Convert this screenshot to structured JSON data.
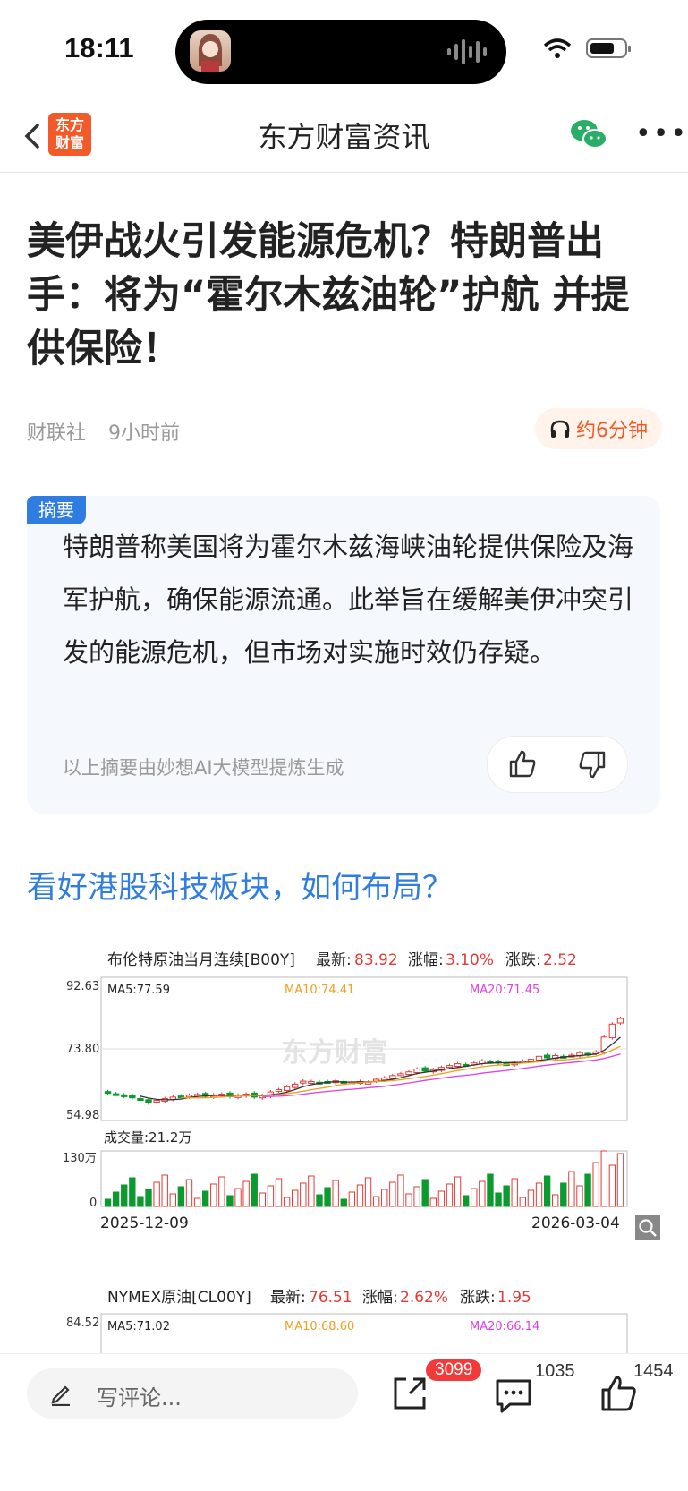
{
  "status": {
    "time": "18:11"
  },
  "nav": {
    "logo_line1": "东方",
    "logo_line2": "财富",
    "title": "东方财富资讯"
  },
  "article": {
    "headline": "美伊战火引发能源危机？特朗普出手：将为“霍尔木兹油轮”护航 并提供保险！",
    "source": "财联社",
    "time_ago": "9小时前",
    "listen_label": "约6分钟"
  },
  "summary": {
    "tag": "摘要",
    "text": "特朗普称美国将为霍尔木兹海峡油轮提供保险及海军护航，确保能源流通。此举旨在缓解美伊冲突引发的能源危机，但市场对实施时效仍存疑。",
    "note": "以上摘要由妙想AI大模型提炼生成"
  },
  "link_title": "看好港股科技板块，如何布局？",
  "chart_data": [
    {
      "type": "candlestick",
      "title": "布伦特原油当月连续[B00Y]",
      "latest_label": "最新:",
      "latest": "83.92",
      "change_pct_label": "涨幅:",
      "change_pct": "3.10%",
      "change_label": "涨跌:",
      "change": "2.52",
      "ma5": "MA5:77.59",
      "ma10": "MA10:74.41",
      "ma20": "MA20:71.45",
      "y_ticks": [
        "92.63",
        "73.80",
        "54.98"
      ],
      "ylim": [
        54.98,
        92.63
      ],
      "watermark": "东方财富",
      "volume_label": "成交量:21.2万",
      "volume_ticks": [
        "130万",
        "0"
      ],
      "x_start": "2025-12-09",
      "x_end": "2026-03-04",
      "close": [
        61.9,
        61.6,
        61.0,
        60.6,
        60.3,
        59.2,
        59.9,
        60.4,
        60.8,
        61.0,
        61.3,
        61.5,
        61.0,
        61.4,
        61.6,
        60.9,
        61.3,
        61.6,
        60.8,
        61.2,
        62.2,
        62.8,
        63.6,
        64.3,
        65.1,
        65.0,
        64.7,
        64.9,
        65.2,
        64.6,
        64.9,
        65.0,
        64.8,
        65.6,
        66.0,
        66.6,
        67.1,
        67.6,
        68.4,
        67.8,
        68.2,
        68.8,
        69.3,
        69.8,
        69.4,
        70.0,
        70.6,
        70.2,
        70.0,
        69.7,
        70.2,
        70.5,
        71.0,
        71.8,
        71.4,
        72.0,
        71.7,
        72.1,
        72.8,
        72.3,
        73.0,
        77.0,
        80.5,
        82.0
      ],
      "series_colors": {
        "up": "#e53935",
        "down": "#0a9a2e",
        "ma5": "#333333",
        "ma10": "#f0a020",
        "ma20": "#e040e0"
      }
    },
    {
      "type": "candlestick",
      "title": "NYMEX原油[CL00Y]",
      "latest_label": "最新:",
      "latest": "76.51",
      "change_pct_label": "涨幅:",
      "change_pct": "2.62%",
      "change_label": "涨跌:",
      "change": "1.95",
      "ma5": "MA5:71.02",
      "ma10": "MA10:68.60",
      "ma20": "MA20:66.14",
      "y_ticks": [
        "84.52"
      ]
    }
  ],
  "bottom_bar": {
    "comment_placeholder": "写评论...",
    "share_count": "3099",
    "comment_count": "1035",
    "like_count": "1454"
  }
}
